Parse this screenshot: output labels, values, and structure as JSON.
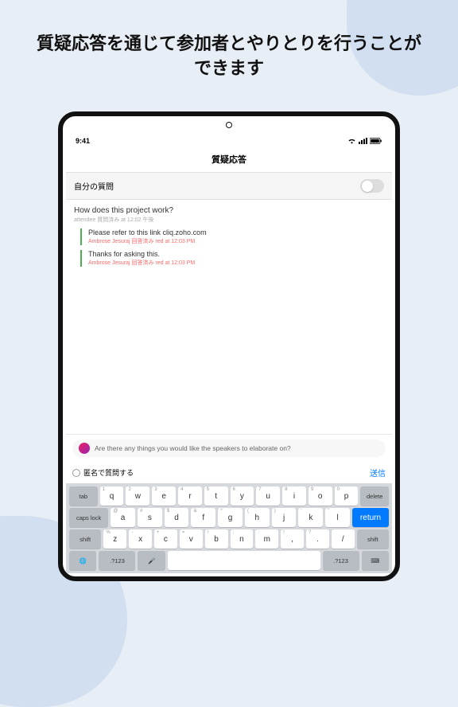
{
  "headline": "質疑応答を通じて参加者とやりとりを行うことができます",
  "status": {
    "time": "9:41"
  },
  "nav": {
    "title": "質疑応答"
  },
  "toggle": {
    "label": "自分の質問"
  },
  "question": {
    "text": "How does this project work?",
    "meta": "attendee 質問済み at 12:02 午後",
    "answers": [
      {
        "text": "Please refer to this link cliq.zoho.com",
        "meta_prefix": "Ambrose Jesuraj 回答済み",
        "meta_suffix": "red at 12:03 PM"
      },
      {
        "text": "Thanks for asking this.",
        "meta_prefix": "Ambrose Jesuraj 回答済み",
        "meta_suffix": "red at 12:03 PM"
      }
    ]
  },
  "input": {
    "placeholder": "Are there any things you would like the speakers to elaborate on?"
  },
  "anon": {
    "label": "匿名で質問する"
  },
  "send": "送信",
  "kb": {
    "r1": {
      "tab": "tab",
      "delete": "delete",
      "k": [
        "q",
        "w",
        "e",
        "r",
        "t",
        "y",
        "u",
        "i",
        "o",
        "p"
      ],
      "a": [
        "1",
        "2",
        "3",
        "4",
        "5",
        "6",
        "7",
        "8",
        "9",
        "0"
      ]
    },
    "r2": {
      "caps": "caps lock",
      "ret": "return",
      "k": [
        "a",
        "s",
        "d",
        "f",
        "g",
        "h",
        "j",
        "k",
        "l"
      ],
      "a": [
        "@",
        "#",
        "$",
        "&",
        "*",
        "(",
        ")",
        "'",
        "\""
      ]
    },
    "r3": {
      "shift": "shift",
      "k": [
        "z",
        "x",
        "c",
        "v",
        "b",
        "n",
        "m",
        ",",
        ".",
        "/"
      ],
      "a": [
        "%",
        "-",
        "+",
        "=",
        "/",
        ";",
        ":",
        "!",
        "?"
      ]
    },
    "r4": {
      "num": ".?123"
    }
  }
}
